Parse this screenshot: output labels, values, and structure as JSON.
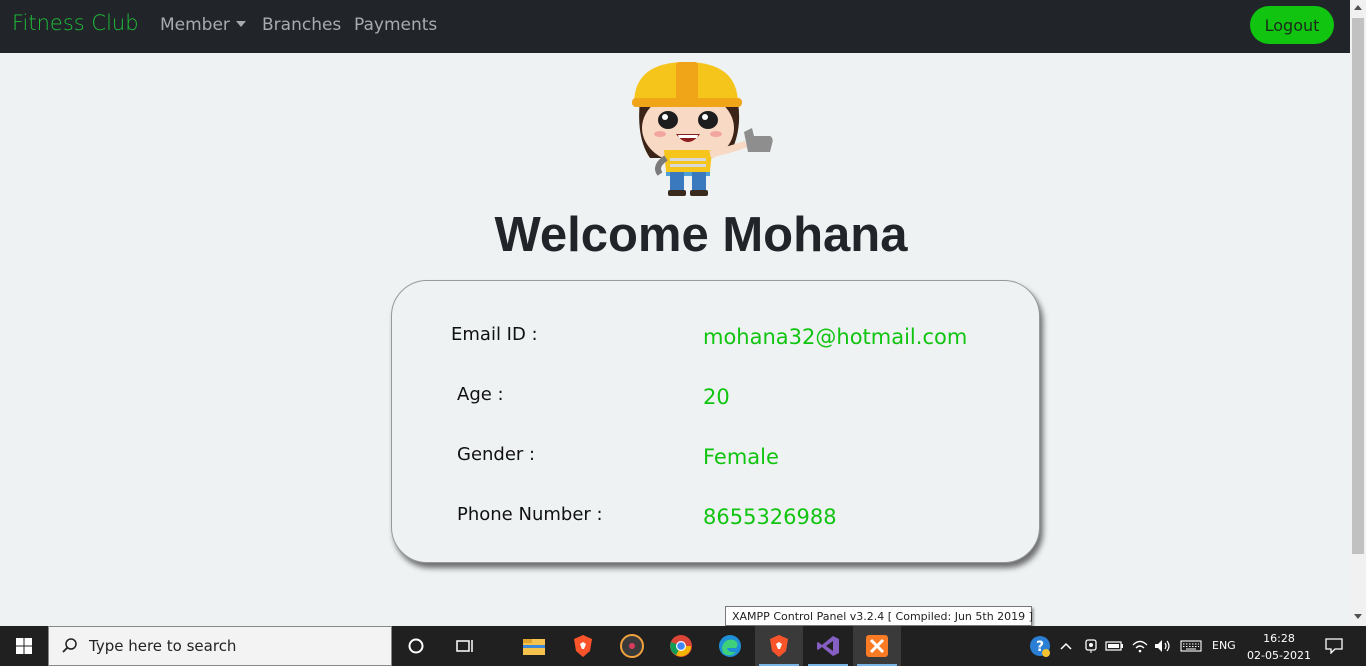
{
  "navbar": {
    "brand": "Fitness Club",
    "links": [
      "Member",
      "Branches",
      "Payments"
    ],
    "logout_label": "Logout"
  },
  "welcome": "Welcome Mohana",
  "profile": {
    "email_label": "Email ID :",
    "email_value": "mohana32@hotmail.com",
    "age_label": "Age :",
    "age_value": "20",
    "gender_label": "Gender :",
    "gender_value": "Female",
    "phone_label": "Phone Number :",
    "phone_value": "8655326988"
  },
  "tooltip": "XAMPP Control Panel v3.2.4   [ Compiled: Jun 5th 2019 ]",
  "taskbar": {
    "search_placeholder": "Type here to search",
    "apps": [
      "task-view",
      "file-explorer",
      "brave",
      "media-player",
      "chrome",
      "edge",
      "brave",
      "visual-studio",
      "xampp"
    ],
    "language": "ENG",
    "time": "16:28",
    "date": "02-05-2021"
  },
  "colors": {
    "accent_green": "#10c410",
    "navbar_bg": "#212529",
    "page_bg": "#eef2f3"
  }
}
